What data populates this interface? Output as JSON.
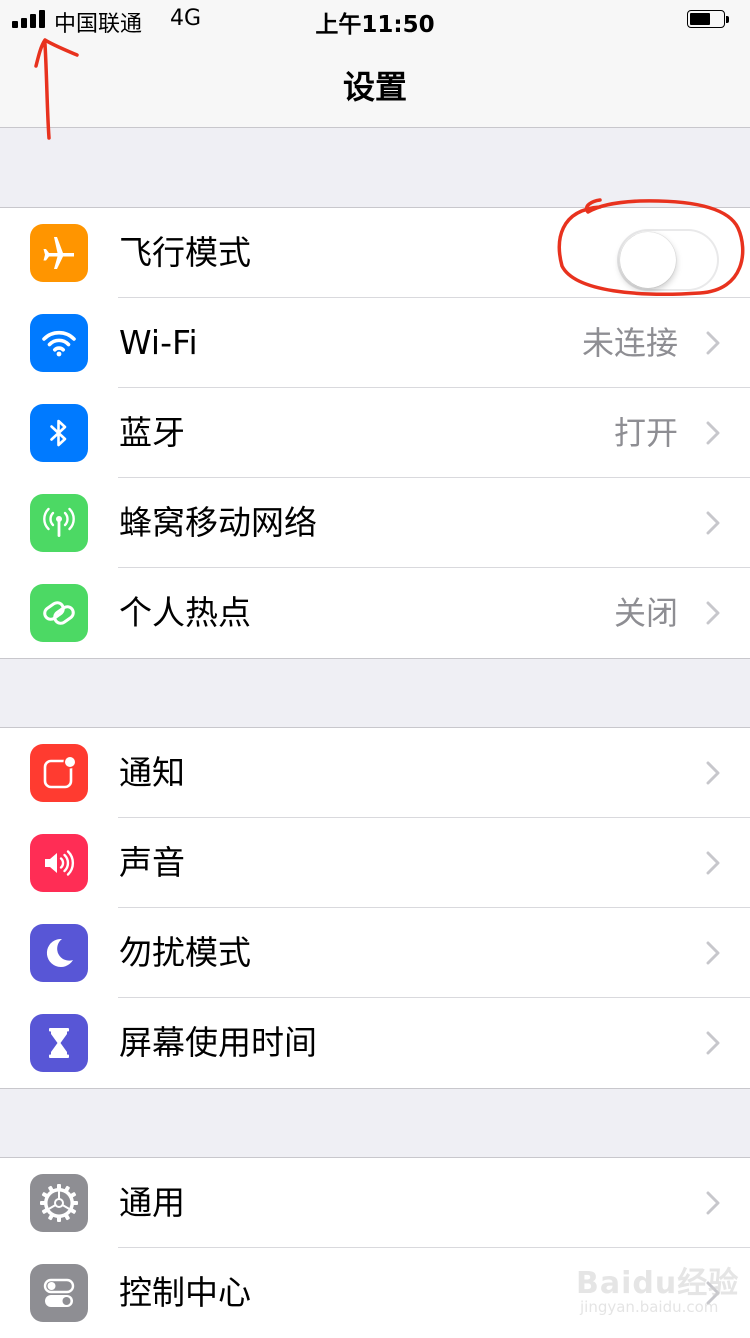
{
  "status_bar": {
    "carrier": "中国联通",
    "network": "4G",
    "time": "上午11:50",
    "battery_level": 0.55
  },
  "nav": {
    "title": "设置"
  },
  "groups": [
    {
      "rows": [
        {
          "label": "飞行模式",
          "icon": "airplane-icon",
          "icon_color": "#ff9500",
          "control": "toggle",
          "toggle_on": false
        },
        {
          "label": "Wi-Fi",
          "value": "未连接",
          "icon": "wifi-icon",
          "icon_color": "#007aff"
        },
        {
          "label": "蓝牙",
          "value": "打开",
          "icon": "bluetooth-icon",
          "icon_color": "#007aff"
        },
        {
          "label": "蜂窝移动网络",
          "value": "",
          "icon": "cellular-antenna-icon",
          "icon_color": "#4cd964"
        },
        {
          "label": "个人热点",
          "value": "关闭",
          "icon": "hotspot-link-icon",
          "icon_color": "#4cd964"
        }
      ]
    },
    {
      "rows": [
        {
          "label": "通知",
          "value": "",
          "icon": "notifications-icon",
          "icon_color": "#ff3b30"
        },
        {
          "label": "声音",
          "value": "",
          "icon": "speaker-icon",
          "icon_color": "#ff2d55"
        },
        {
          "label": "勿扰模式",
          "value": "",
          "icon": "moon-icon",
          "icon_color": "#5856d6"
        },
        {
          "label": "屏幕使用时间",
          "value": "",
          "icon": "hourglass-icon",
          "icon_color": "#5856d6"
        }
      ]
    },
    {
      "rows": [
        {
          "label": "通用",
          "value": "",
          "icon": "gear-icon",
          "icon_color": "#8e8e93"
        },
        {
          "label": "控制中心",
          "value": "",
          "icon": "control-center-icon",
          "icon_color": "#8e8e93"
        }
      ]
    }
  ],
  "watermark": {
    "brand": "Baidu经验",
    "url": "jingyan.baidu.com"
  },
  "colors": {
    "background": "#efeff4",
    "annotation": "#e8321e",
    "secondary_text": "#8e8e93",
    "separator": "#c8c7cc"
  }
}
